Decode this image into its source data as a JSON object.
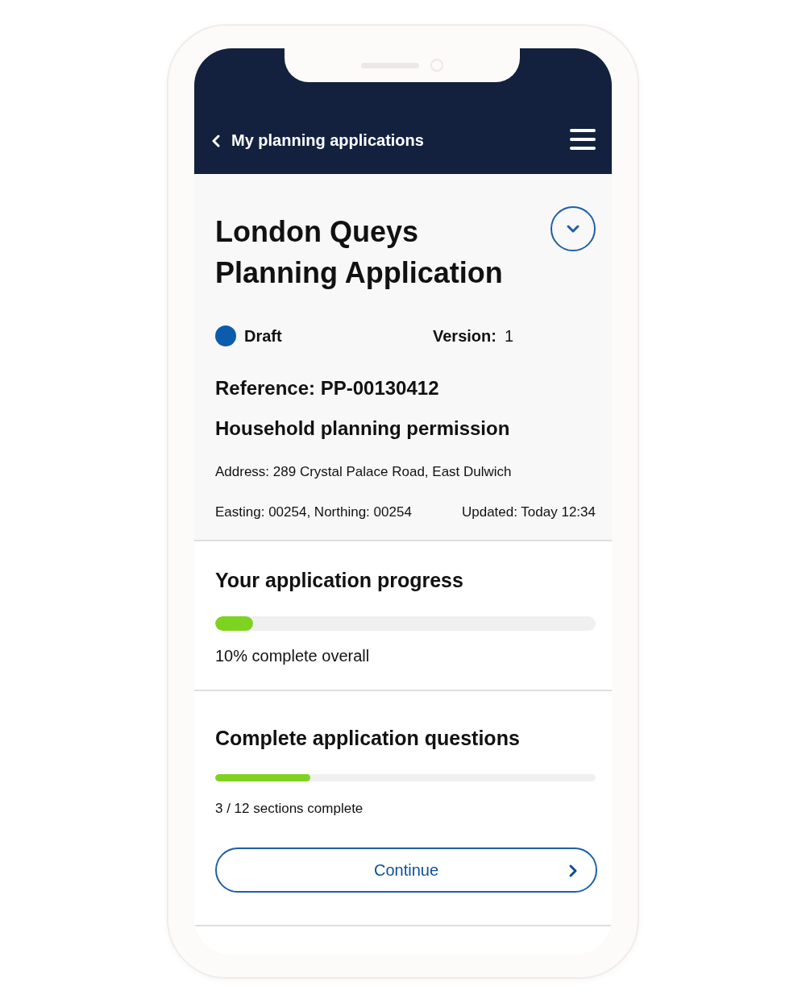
{
  "header": {
    "back_label": "My planning applications"
  },
  "application": {
    "title": "London Queys Planning Application",
    "expanded": false,
    "status": "Draft",
    "version_label": "Version:",
    "version": "1",
    "reference": "Reference: PP-00130412",
    "type": "Household planning permission",
    "address": "Address: 289 Crystal Palace Road, East Dulwich",
    "coordinates": "Easting: 00254, Northing: 00254",
    "updated": "Updated: Today 12:34"
  },
  "progress": {
    "title": "Your application progress",
    "level": 0.1,
    "caption": "10% complete overall"
  },
  "questions": {
    "title": "Complete application questions",
    "level": 0.25,
    "caption": "3 / 12 sections complete",
    "button": "Continue"
  }
}
